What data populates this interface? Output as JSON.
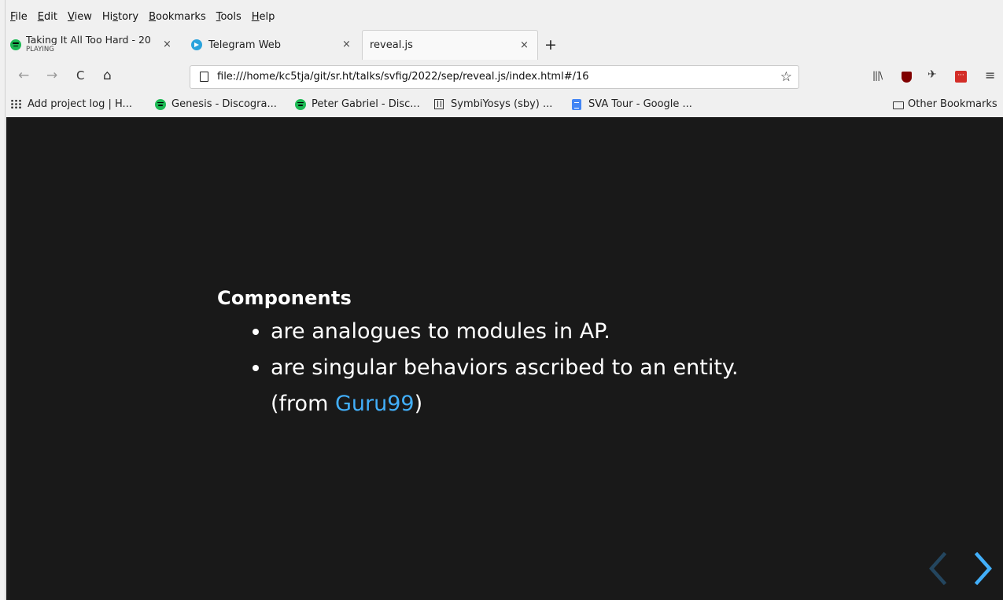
{
  "menu": {
    "items": [
      "File",
      "Edit",
      "View",
      "History",
      "Bookmarks",
      "Tools",
      "Help"
    ],
    "underline": [
      "F",
      "E",
      "V",
      "s",
      "B",
      "T",
      "H"
    ]
  },
  "tabs": [
    {
      "title": "Taking It All Too Hard - 20",
      "subtitle": "PLAYING",
      "icon": "spotify-icon",
      "close": "×"
    },
    {
      "title": "Telegram Web",
      "icon": "telegram-icon",
      "close": "×"
    },
    {
      "title": "reveal.js",
      "close": "×",
      "active": true
    }
  ],
  "new_tab": "+",
  "nav": {
    "back": "←",
    "forward": "→",
    "reload": "C",
    "home": "⌂",
    "url": "file:///home/kc5tja/git/sr.ht/talks/svfig/2022/sep/reveal.js/index.html#/16",
    "star": "☆"
  },
  "toolbar": {
    "library": "|||\\",
    "menu": "≡"
  },
  "bookmarks": [
    {
      "label": "Add project log | H...",
      "icon": "hackaday-icon"
    },
    {
      "label": "Genesis - Discogra...",
      "icon": "spotify-icon"
    },
    {
      "label": "Peter Gabriel - Disc...",
      "icon": "spotify-icon"
    },
    {
      "label": "SymbiYosys (sby) ...",
      "icon": "symbiyosys-icon"
    },
    {
      "label": "SVA Tour - Google ...",
      "icon": "google-docs-icon"
    }
  ],
  "other_bookmarks": "Other Bookmarks",
  "slide": {
    "heading": "Components",
    "bullets": [
      "are analogues to modules in AP.",
      "are singular behaviors ascribed to an entity."
    ],
    "cite_prefix": "(from ",
    "cite_link": "Guru99",
    "cite_suffix": ")"
  },
  "controls": {
    "prev": "〈",
    "next": "〉"
  },
  "colors": {
    "slide_bg": "#191919",
    "link": "#42affa",
    "spotify": "#1db954",
    "telegram": "#2aa3dc"
  }
}
